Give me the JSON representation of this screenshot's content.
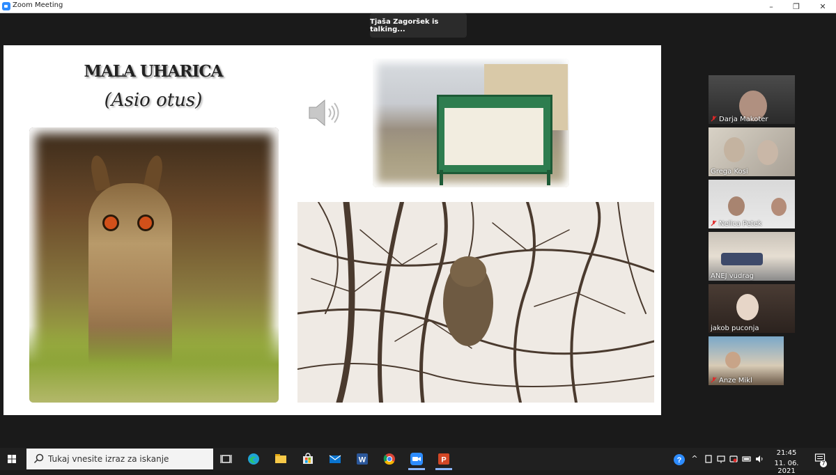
{
  "window": {
    "title": "Zoom Meeting",
    "min_label": "–",
    "max_label": "❐",
    "close_label": "✕"
  },
  "banner": {
    "talking": "Tjaša Zagoršek is talking..."
  },
  "slide": {
    "title": "MALA UHARICA",
    "subtitle": "(Asio otus)"
  },
  "participants": [
    {
      "name": "Darja Makoter",
      "muted": true
    },
    {
      "name": "Grega Kosi",
      "muted": false
    },
    {
      "name": "Nelica Petek",
      "muted": true
    },
    {
      "name": "ANEJ vudrag",
      "muted": false
    },
    {
      "name": "jakob puconja",
      "muted": false
    },
    {
      "name": "Anze Mikl",
      "muted": true
    }
  ],
  "taskbar": {
    "search_placeholder": "Tukaj vnesite izraz za iskanje",
    "apps": [
      "task-view",
      "edge",
      "file-explorer",
      "store",
      "mail",
      "word",
      "chrome",
      "zoom",
      "powerpoint"
    ],
    "time": "21:45",
    "date": "11. 06. 2021",
    "notification_count": "7"
  },
  "colors": {
    "accent": "#2d8cff",
    "muted_mic": "#e02828",
    "taskbar": "#202020"
  }
}
